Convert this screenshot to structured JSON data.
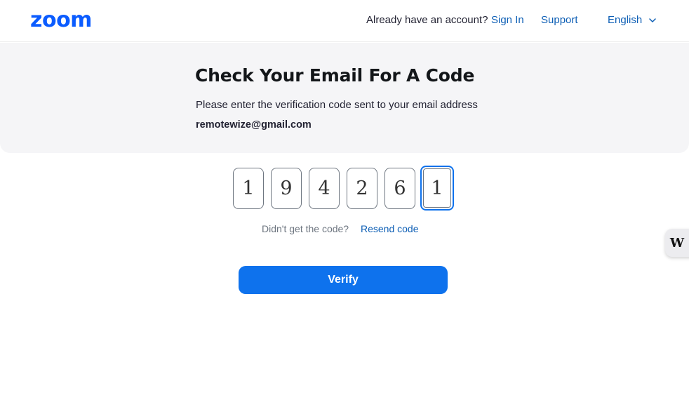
{
  "header": {
    "logo_text": "zoom",
    "already_text": "Already have an account?",
    "signin_label": "Sign In",
    "support_label": "Support",
    "language_label": "English"
  },
  "panel": {
    "title": "Check Your Email For A Code",
    "subtitle": "Please enter the verification code sent to your email address",
    "email": "remotewize@gmail.com"
  },
  "code": {
    "digits": [
      "1",
      "9",
      "4",
      "2",
      "6",
      "1"
    ]
  },
  "resend": {
    "prompt": "Didn't get the code?",
    "link_label": "Resend code"
  },
  "verify": {
    "label": "Verify"
  },
  "side_widget": {
    "label": "W"
  },
  "colors": {
    "brand": "#0b5cff",
    "link": "#0e5fb5",
    "button": "#0e72ed",
    "panel_bg": "#f5f5f7"
  }
}
